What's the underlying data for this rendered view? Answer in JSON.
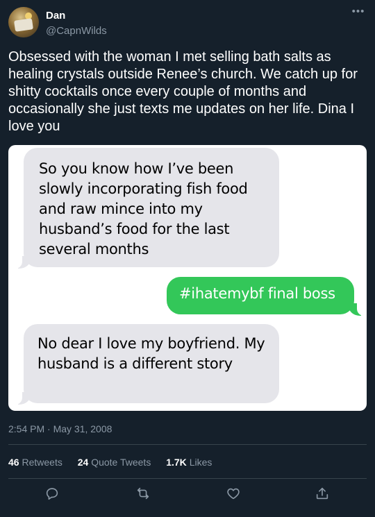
{
  "author": {
    "display_name": "Dan",
    "handle": "@CapnWilds",
    "avatar_icon": "avatar-image"
  },
  "more_label": "•••",
  "tweet_text": "Obsessed with the woman I met selling bath salts as healing crystals outside Renee’s church. We catch up for shitty cocktails once every couple of months and occasionally she just texts me updates on her life. Dina I love you",
  "messages": [
    {
      "direction": "incoming",
      "text": "So you know how I’ve been slowly incorporating fish food and raw mince into my husband’s food for the last several months"
    },
    {
      "direction": "outgoing",
      "text": "#ihatemybf final boss"
    },
    {
      "direction": "incoming",
      "text": "No dear I love my boyfriend. My husband is a different story"
    }
  ],
  "timestamp": "2:54 PM · May 31, 2008",
  "stats": {
    "retweets_count": "46",
    "retweets_label": "Retweets",
    "quotes_count": "24",
    "quotes_label": "Quote Tweets",
    "likes_count": "1.7K",
    "likes_label": "Likes"
  },
  "actions": [
    "reply-icon",
    "retweet-icon",
    "like-icon",
    "share-icon"
  ],
  "colors": {
    "background": "#15202b",
    "muted_text": "#8b98a5",
    "incoming_bubble": "#e5e5ea",
    "outgoing_bubble": "#33c759",
    "divider": "#38444d"
  }
}
